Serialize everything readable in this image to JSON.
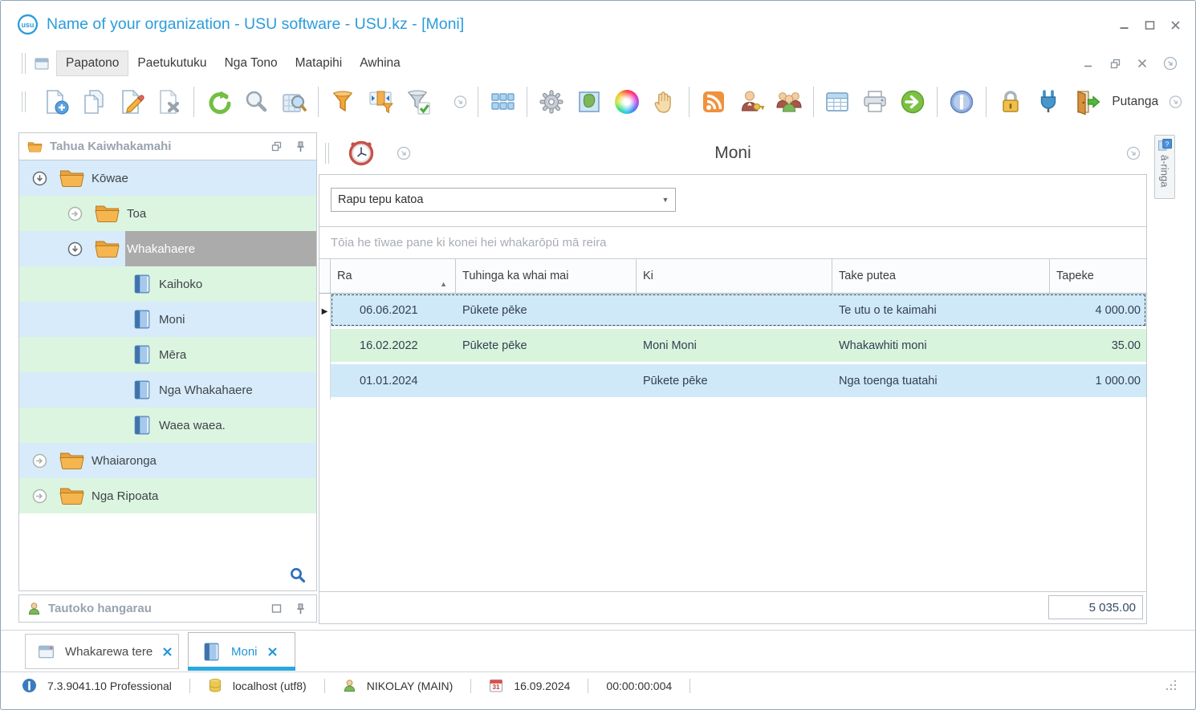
{
  "window": {
    "title": "Name of your organization - USU software - USU.kz - [Moni]",
    "logo_text": "usu"
  },
  "menu": {
    "items": [
      "Papatono",
      "Paetukutuku",
      "Nga Tono",
      "Matapihi",
      "Awhina"
    ],
    "active": "Papatono"
  },
  "toolbar": {
    "exit_label": "Putanga",
    "icons": [
      "new-record",
      "copy-record",
      "edit-record",
      "delete-record",
      "refresh",
      "search",
      "search-in-table",
      "filter",
      "filter-by-selection",
      "filter-with-check",
      "more-options",
      "layout-grid",
      "settings-gear",
      "map",
      "color-wheel",
      "drag-hand",
      "rss-feed",
      "user-permissions",
      "users-group",
      "table-view",
      "print",
      "export-arrow",
      "info",
      "lock",
      "plugin",
      "exit-door"
    ]
  },
  "sidebar": {
    "title": "Tahua Kaiwhakamahi",
    "support_title": "Tautoko hangarau",
    "items": [
      {
        "label": "Kōwae",
        "level": 0,
        "type": "folder",
        "state": "expanded"
      },
      {
        "label": "Toa",
        "level": 1,
        "type": "folder",
        "state": "collapsed"
      },
      {
        "label": "Whakahaere",
        "level": 1,
        "type": "folder",
        "state": "expanded",
        "selected": true
      },
      {
        "label": "Kaihoko",
        "level": 2,
        "type": "book"
      },
      {
        "label": "Moni",
        "level": 2,
        "type": "book"
      },
      {
        "label": "Mēra",
        "level": 2,
        "type": "book"
      },
      {
        "label": "Nga Whakahaere",
        "level": 2,
        "type": "book"
      },
      {
        "label": "Waea waea.",
        "level": 2,
        "type": "book"
      },
      {
        "label": "Whaiaronga",
        "level": 0,
        "type": "folder",
        "state": "collapsed"
      },
      {
        "label": "Nga Ripoata",
        "level": 0,
        "type": "folder",
        "state": "collapsed"
      }
    ]
  },
  "main": {
    "title": "Moni",
    "search_value": "Rapu tepu katoa",
    "group_hint": "Tōia he tīwae pane ki konei hei whakarōpū mā reira",
    "side_tab": "ā-ringa",
    "table": {
      "columns": [
        "Ra",
        "Tuhinga ka whai mai",
        "Ki",
        "Take putea",
        "Tapeke"
      ],
      "sort_column": "Ra",
      "sort_direction": "asc",
      "sort_glyph": "▲",
      "row_marker": "▶",
      "rows": [
        {
          "cells": [
            "06.06.2021",
            "Pūkete pēke",
            "",
            "Te utu o te kaimahi",
            "4 000.00"
          ],
          "selected": true,
          "bg": "blue"
        },
        {
          "cells": [
            "16.02.2022",
            "Pūkete pēke",
            "Moni Moni",
            "Whakawhiti moni",
            "35.00"
          ],
          "selected": false,
          "bg": "green"
        },
        {
          "cells": [
            "01.01.2024",
            "",
            "Pūkete pēke",
            "Nga toenga tuatahi",
            "1 000.00"
          ],
          "selected": false,
          "bg": "blue"
        }
      ],
      "total": "5 035.00"
    }
  },
  "tabs": [
    {
      "label": "Whakarewa tere",
      "active": false
    },
    {
      "label": "Moni",
      "active": true
    }
  ],
  "statusbar": {
    "version": "7.3.9041.10 Professional",
    "database": "localhost (utf8)",
    "user": "NIKOLAY (MAIN)",
    "date": "16.09.2024",
    "timer": "00:00:00:004",
    "calendar_day": "31"
  },
  "icons": {
    "combo_arrow": "▼",
    "help_glyph": "?",
    "colors": {
      "accent_blue": "#29a8e0",
      "title_blue": "#2b9cdb",
      "tree_row_blue": "#d7ebfa",
      "tree_row_green": "#dcf5e0",
      "table_row_blue": "#cfe9f8",
      "table_row_green": "#d9f4dd",
      "selection_gray": "#ababab"
    }
  }
}
